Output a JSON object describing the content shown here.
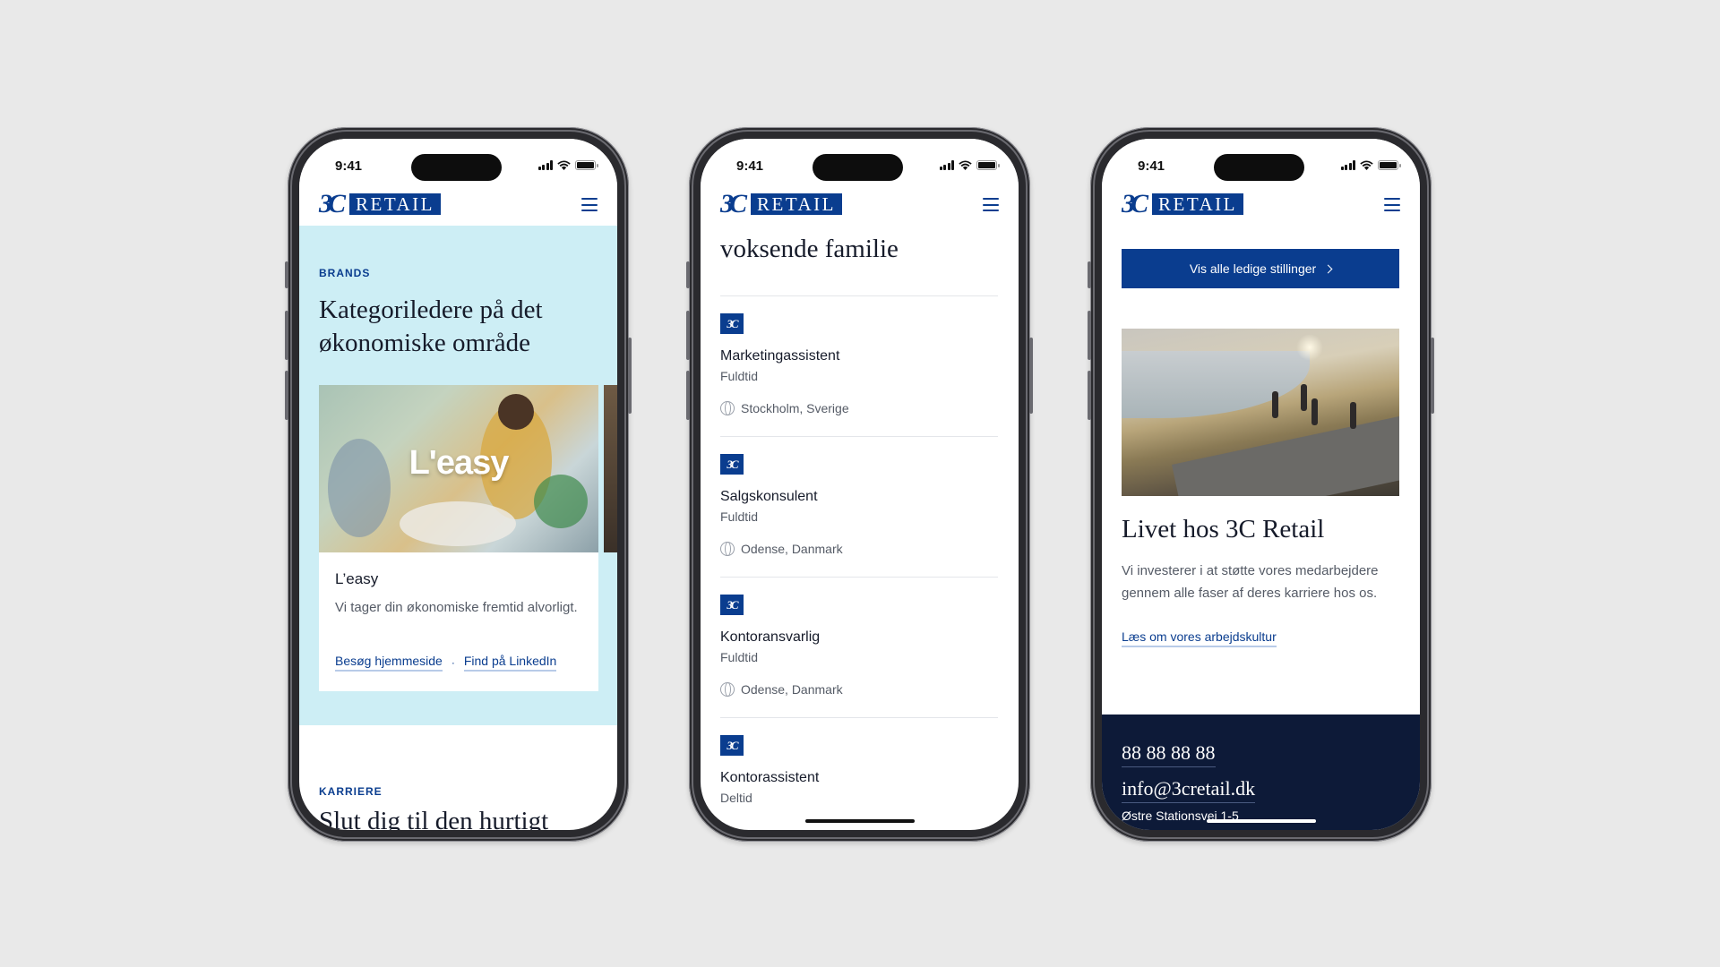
{
  "status": {
    "time": "9:41"
  },
  "brand": {
    "mark": "3C",
    "wordmark": "RETAIL",
    "primary_color": "#0a3d8f"
  },
  "phone1": {
    "eyebrow": "BRANDS",
    "title": "Kategoriledere på det økonomiske område",
    "card": {
      "image_label": "L'easy",
      "name": "L’easy",
      "description": "Vi tager din økonomiske fremtid alvorligt.",
      "link_homepage": "Besøg hjemmeside",
      "separator": "·",
      "link_linkedin": "Find på LinkedIn"
    },
    "eyebrow2": "KARRIERE",
    "title2": "Slut dig til den hurtigt"
  },
  "phone2": {
    "clipped_title": "voksende familie",
    "jobs": [
      {
        "title": "Marketingassistent",
        "type": "Fuldtid",
        "location": "Stockholm, Sverige"
      },
      {
        "title": "Salgskonsulent",
        "type": "Fuldtid",
        "location": "Odense, Danmark"
      },
      {
        "title": "Kontoransvarlig",
        "type": "Fuldtid",
        "location": "Odense, Danmark"
      },
      {
        "title": "Kontorassistent",
        "type": "Deltid",
        "location": ""
      }
    ]
  },
  "phone3": {
    "cta": "Vis alle ledige stillinger",
    "life_title": "Livet hos 3C Retail",
    "life_desc": "Vi investerer i at støtte vores medarbejdere gennem alle faser af deres karriere hos os.",
    "life_link": "Læs om vores arbejdskultur",
    "footer": {
      "phone": "88 88 88 88",
      "email": "info@3cretail.dk",
      "address": "Østre Stationsvej 1-5"
    }
  }
}
